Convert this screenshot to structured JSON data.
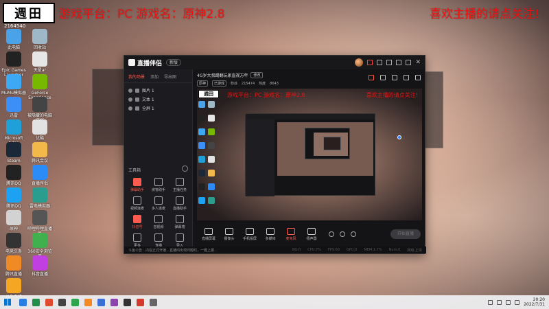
{
  "stream_overlay": {
    "left_text": "游戏平台：PC 游戏名：原神2.8",
    "right_text": "喜欢主播的请点关注!"
  },
  "logo": {
    "text": "週田",
    "sub": "2164540"
  },
  "desktop_icons": [
    {
      "label": "此电脑",
      "color": "#4aa3e8"
    },
    {
      "label": "回收站",
      "color": "#9fb8c8"
    },
    {
      "label": "Epic Games Launcher",
      "color": "#222222"
    },
    {
      "label": "天星ar",
      "color": "#e6e6e6"
    },
    {
      "label": "MuMu模拟器",
      "color": "#3da9f5"
    },
    {
      "label": "GeForce Experience",
      "color": "#76b900"
    },
    {
      "label": "迅雷",
      "color": "#3b8ff7"
    },
    {
      "label": "被隐藏的电脑文档",
      "color": "#444444"
    },
    {
      "label": "Microsoft Edge",
      "color": "#1fa0d8"
    },
    {
      "label": "优酷",
      "color": "#e2e2e2"
    },
    {
      "label": "Steam",
      "color": "#1b2838"
    },
    {
      "label": "腾讯会议",
      "color": "#f2b94a"
    },
    {
      "label": "腾讯QQ",
      "color": "#222222"
    },
    {
      "label": "直播伴侣",
      "color": "#2b8cf7"
    },
    {
      "label": "腾讯QQ",
      "color": "#1da1f2"
    },
    {
      "label": "雷电模拟器",
      "color": "#2a9d8f"
    },
    {
      "label": "原神",
      "color": "#d2d2d2"
    },
    {
      "label": "哔哩哔哩直播姬",
      "color": "#555555"
    },
    {
      "label": "电竞头条",
      "color": "#333333"
    },
    {
      "label": "360安全浏览器",
      "color": "#3fb04d"
    },
    {
      "label": "腾讯直播",
      "color": "#f08a24"
    },
    {
      "label": "抖音直播",
      "color": "#c13ee0"
    },
    {
      "label": "斗鱼直播",
      "color": "#f5a623"
    }
  ],
  "app": {
    "title": "直播伴侣",
    "version": "新版",
    "left_tabs": [
      "我的场景",
      "添加",
      "导出图"
    ],
    "scenes": [
      {
        "label": "图片 1"
      },
      {
        "label": "文本 1"
      },
      {
        "label": "全屏 1"
      }
    ],
    "tools_title": "工具箱",
    "tools": [
      {
        "label": "弹幕助手",
        "highlight": true
      },
      {
        "label": "房管助手",
        "highlight": false
      },
      {
        "label": "主播任务",
        "highlight": false
      },
      {
        "label": "视频连麦",
        "highlight": false
      },
      {
        "label": "多人连麦",
        "highlight": false
      },
      {
        "label": "直播助手",
        "highlight": false
      },
      {
        "label": "抖音号",
        "highlight": true
      },
      {
        "label": "音视频",
        "highlight": false
      },
      {
        "label": "弹幕墙",
        "highlight": false
      },
      {
        "label": "更多",
        "highlight": false
      },
      {
        "label": "直播",
        "highlight": false
      },
      {
        "label": "导入",
        "highlight": false
      }
    ],
    "stream_title": "4G岁大叔踢翻玩家直视万年",
    "edit_label": "修改",
    "meta": {
      "tag1": "原神",
      "tag2": "已游戏",
      "label_a": "粉丝",
      "value_a": "215474",
      "label_b": "热度",
      "value_b": "8643"
    },
    "preview_overlay_left": "游戏平台：PC 游戏名：原神2.8",
    "preview_overlay_right": "喜欢主播的请点关注!",
    "controls": [
      {
        "label": "直播屏幕",
        "red": false
      },
      {
        "label": "摄像头",
        "red": false
      },
      {
        "label": "手机投屏",
        "red": false
      },
      {
        "label": "多媒体",
        "red": false
      },
      {
        "label": "麦克风",
        "red": true
      },
      {
        "label": "扬声器",
        "red": false
      }
    ],
    "start_label": "开始直播",
    "status_notice": "斗鱼公告：内容正式开播，直播间出现问题时，一键上报...",
    "stats": [
      "BG:0",
      "CPU:7%",
      "FPS:60",
      "GPU:0",
      "MEM:1.7%",
      "Num:0",
      "网络:正常"
    ]
  },
  "taskbar": {
    "apps": [
      "#2a7de1",
      "#1f8f4b",
      "#e04a2f",
      "#444444",
      "#2ea44f",
      "#f58a24",
      "#3b6fd8",
      "#8e44ad",
      "#333333",
      "#d33a2c",
      "#666666"
    ],
    "time": "20:20",
    "date": "2022/7/31"
  }
}
